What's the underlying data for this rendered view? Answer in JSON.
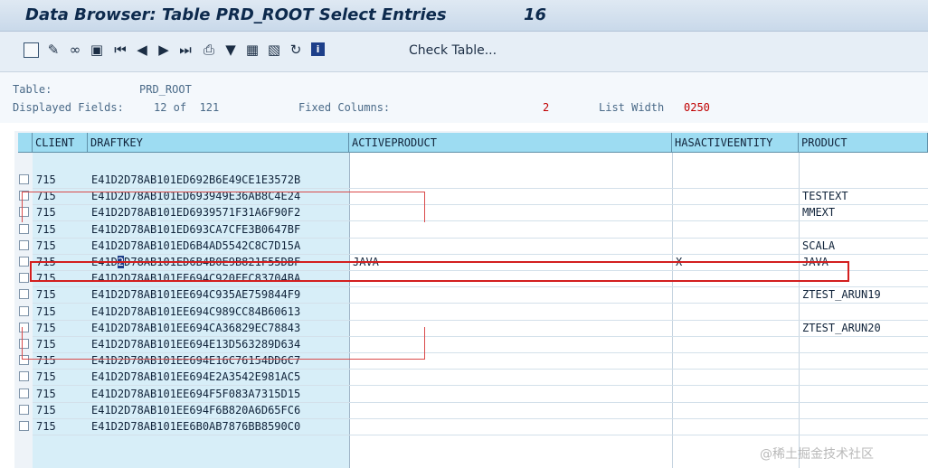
{
  "window": {
    "title": "Data Browser: Table PRD_ROOT Select Entries",
    "entry_count": "16"
  },
  "toolbar": {
    "icons": [
      "new-document-icon",
      "edit-pencil-icon",
      "glasses-display-icon",
      "check-detail-icon",
      "first-page-icon",
      "previous-page-icon",
      "next-page-icon",
      "last-page-icon",
      "print-icon",
      "filter-icon",
      "sort-ascending-icon",
      "sort-descending-icon",
      "refresh-icon",
      "info-icon"
    ],
    "check_table_label": "Check Table..."
  },
  "info": {
    "table_label": "Table:",
    "table_value": "PRD_ROOT",
    "displayed_fields_label": "Displayed Fields:",
    "displayed_fields_value": "12 of  121",
    "fixed_columns_label": "Fixed Columns:",
    "fixed_columns_value": "2",
    "list_width_label": "List Width",
    "list_width_value": "0250"
  },
  "grid": {
    "columns": [
      "CLIENT",
      "DRAFTKEY",
      "ACTIVEPRODUCT",
      "HASACTIVEENTITY",
      "PRODUCT"
    ],
    "rows": [
      {
        "client": "715",
        "draftkey": "E41D2D78AB101ED692B6E49CE1E3572B",
        "activeproduct": "",
        "hasactive": "",
        "product": ""
      },
      {
        "client": "715",
        "draftkey": "E41D2D78AB101ED693949E36AB8C4E24",
        "activeproduct": "",
        "hasactive": "",
        "product": "TESTEXT"
      },
      {
        "client": "715",
        "draftkey": "E41D2D78AB101ED6939571F31A6F90F2",
        "activeproduct": "",
        "hasactive": "",
        "product": "MMEXT"
      },
      {
        "client": "715",
        "draftkey": "E41D2D78AB101ED693CA7CFE3B0647BF",
        "activeproduct": "",
        "hasactive": "",
        "product": ""
      },
      {
        "client": "715",
        "draftkey": "E41D2D78AB101ED6B4AD5542C8C7D15A",
        "activeproduct": "",
        "hasactive": "",
        "product": "SCALA"
      },
      {
        "client": "715",
        "draftkey": "E41D2D78AB101ED6B4B0E9B821F55DBF",
        "activeproduct": "JAVA",
        "hasactive": "X",
        "product": "JAVA"
      },
      {
        "client": "715",
        "draftkey": "E41D2D78AB101EE694C920FEC83704BA",
        "activeproduct": "",
        "hasactive": "",
        "product": ""
      },
      {
        "client": "715",
        "draftkey": "E41D2D78AB101EE694C935AE759844F9",
        "activeproduct": "",
        "hasactive": "",
        "product": "ZTEST_ARUN19"
      },
      {
        "client": "715",
        "draftkey": "E41D2D78AB101EE694C989CC84B60613",
        "activeproduct": "",
        "hasactive": "",
        "product": ""
      },
      {
        "client": "715",
        "draftkey": "E41D2D78AB101EE694CA36829EC78843",
        "activeproduct": "",
        "hasactive": "",
        "product": "ZTEST_ARUN20"
      },
      {
        "client": "715",
        "draftkey": "E41D2D78AB101EE694E13D563289D634",
        "activeproduct": "",
        "hasactive": "",
        "product": ""
      },
      {
        "client": "715",
        "draftkey": "E41D2D78AB101EE694E16C76154DD6C7",
        "activeproduct": "",
        "hasactive": "",
        "product": ""
      },
      {
        "client": "715",
        "draftkey": "E41D2D78AB101EE694E2A3542E981AC5",
        "activeproduct": "",
        "hasactive": "",
        "product": ""
      },
      {
        "client": "715",
        "draftkey": "E41D2D78AB101EE694F5F083A7315D15",
        "activeproduct": "",
        "hasactive": "",
        "product": ""
      },
      {
        "client": "715",
        "draftkey": "E41D2D78AB101EE694F6B820A6D65FC6",
        "activeproduct": "",
        "hasactive": "",
        "product": ""
      },
      {
        "client": "715",
        "draftkey": "E41D2D78AB101EE6B0AB7876BB8590C0",
        "activeproduct": "",
        "hasactive": "",
        "product": ""
      }
    ]
  },
  "watermark": "@稀土掘金技术社区",
  "colors": {
    "header_bg": "#9ddcf2",
    "key_col_bg": "#d7eef8",
    "highlight_red": "#d31f1f"
  }
}
